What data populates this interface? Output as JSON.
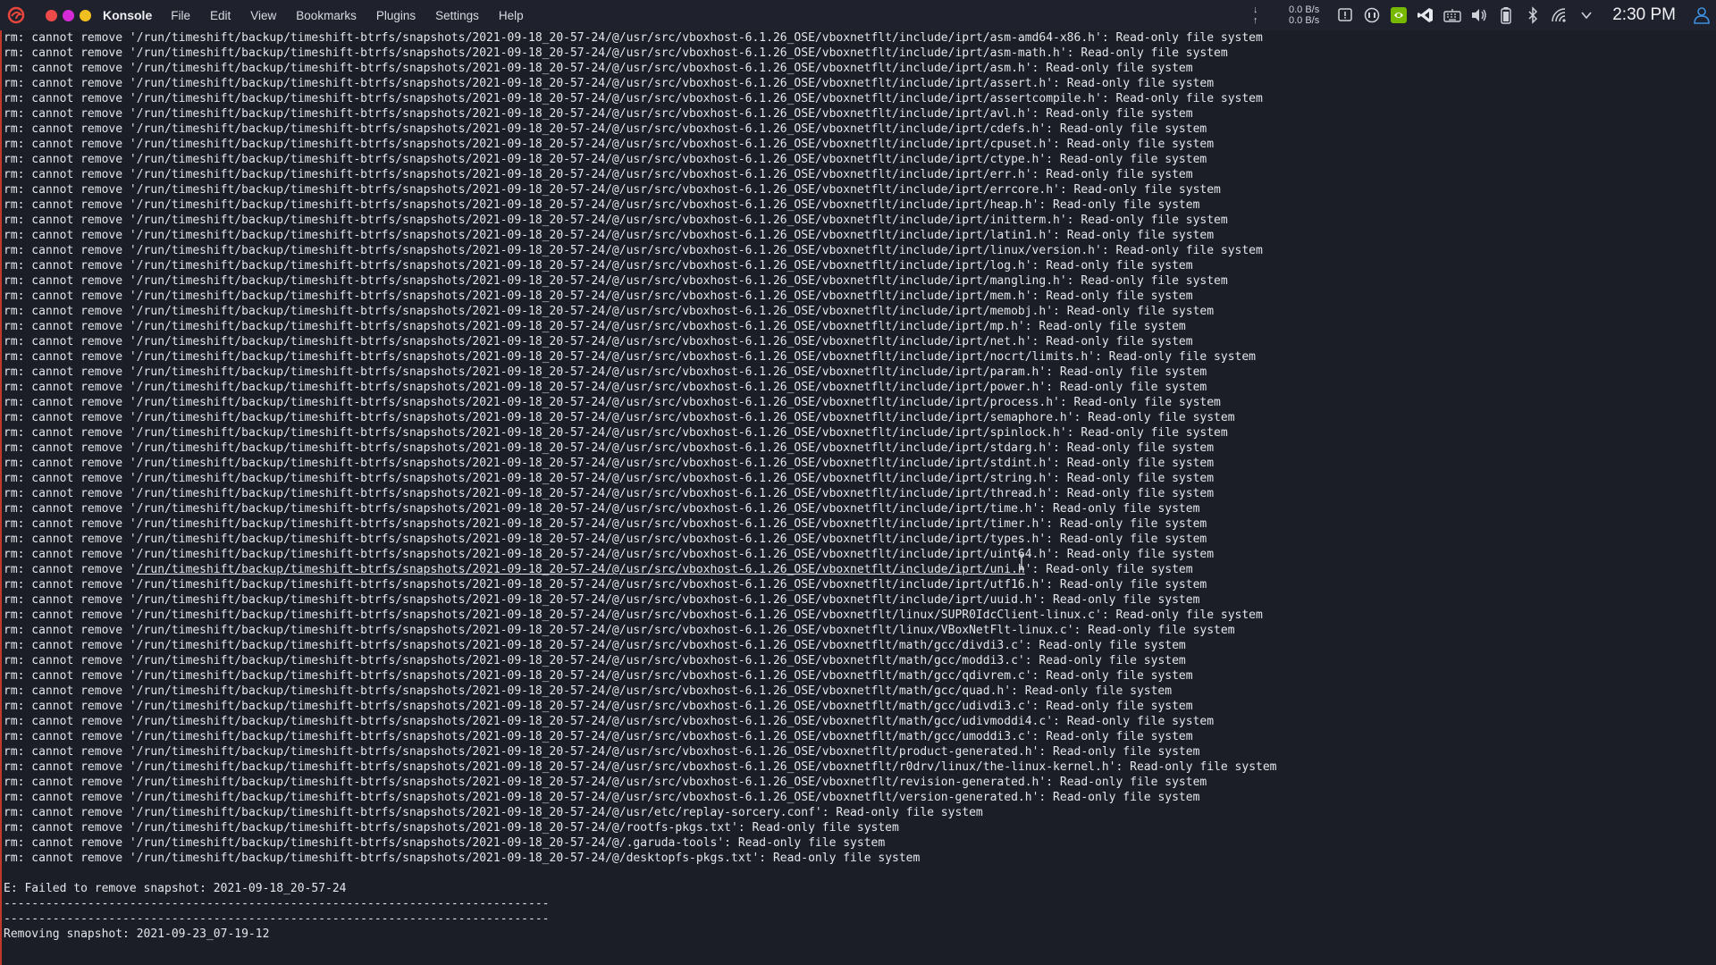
{
  "menubar": {
    "app_name": "Konsole",
    "menu_items": [
      "File",
      "Edit",
      "View",
      "Bookmarks",
      "Plugins",
      "Settings",
      "Help"
    ],
    "net_down": "0.0 B/s",
    "net_up": "0.0 B/s",
    "net_down_arrow": "↓",
    "net_up_arrow": "↑",
    "clock": "2:30 PM",
    "tray_icons": [
      "notification-icon",
      "gamepad-icon",
      "nvidia-icon",
      "vscode-icon",
      "keyboard-icon",
      "volume-icon",
      "battery-icon",
      "bluetooth-icon",
      "wifi-icon",
      "chevron-down-icon",
      "user-icon"
    ],
    "colors": {
      "close": "#ef4a4a",
      "minimize": "#d62ad6",
      "maximize": "#f0c020",
      "accent": "#c0392b"
    }
  },
  "terminal": {
    "prefix": "rm: cannot remove '",
    "base": "/run/timeshift/backup/timeshift-btrfs/snapshots/2021-09-18_20-57-24/@",
    "vbox": "/usr/src/vboxhost-6.1.26_OSE/vboxnetflt/",
    "suffix": "': Read-only file system",
    "vbox_paths": [
      "include/iprt/asm-amd64-x86.h",
      "include/iprt/asm-math.h",
      "include/iprt/asm.h",
      "include/iprt/assert.h",
      "include/iprt/assertcompile.h",
      "include/iprt/avl.h",
      "include/iprt/cdefs.h",
      "include/iprt/cpuset.h",
      "include/iprt/ctype.h",
      "include/iprt/err.h",
      "include/iprt/errcore.h",
      "include/iprt/heap.h",
      "include/iprt/initterm.h",
      "include/iprt/latin1.h",
      "include/iprt/linux/version.h",
      "include/iprt/log.h",
      "include/iprt/mangling.h",
      "include/iprt/mem.h",
      "include/iprt/memobj.h",
      "include/iprt/mp.h",
      "include/iprt/net.h",
      "include/iprt/nocrt/limits.h",
      "include/iprt/param.h",
      "include/iprt/power.h",
      "include/iprt/process.h",
      "include/iprt/semaphore.h",
      "include/iprt/spinlock.h",
      "include/iprt/stdarg.h",
      "include/iprt/stdint.h",
      "include/iprt/string.h",
      "include/iprt/thread.h",
      "include/iprt/time.h",
      "include/iprt/timer.h",
      "include/iprt/types.h",
      "include/iprt/uint64.h",
      "include/iprt/uni.h",
      "include/iprt/utf16.h",
      "include/iprt/uuid.h",
      "linux/SUPR0IdcClient-linux.c",
      "linux/VBoxNetFlt-linux.c",
      "math/gcc/divdi3.c",
      "math/gcc/moddi3.c",
      "math/gcc/qdivrem.c",
      "math/gcc/quad.h",
      "math/gcc/udivdi3.c",
      "math/gcc/udivmoddi4.c",
      "math/gcc/umoddi3.c",
      "product-generated.h",
      "r0drv/linux/the-linux-kernel.h",
      "revision-generated.h",
      "version-generated.h"
    ],
    "other_paths": [
      "/usr/etc/replay-sorcery.conf",
      "/rootfs-pkgs.txt",
      "/.garuda-tools",
      "/desktopfs-pkgs.txt"
    ],
    "underlined_path": "include/iprt/uni.h",
    "error_line": "E: Failed to remove snapshot: 2021-09-18_20-57-24",
    "separator": "------------------------------------------------------------------------------",
    "removing_line": "Removing snapshot: 2021-09-23_07-19-12"
  }
}
